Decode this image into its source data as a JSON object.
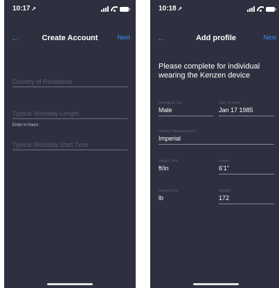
{
  "left": {
    "status_time": "10:17",
    "status_arrow": "➚",
    "title": "Create Account",
    "back": "←",
    "next": "Next",
    "fields": {
      "country_placeholder": "Country of Residence",
      "workday_length_placeholder": "Typical Workday Length",
      "workday_length_hint": "Enter in hours",
      "workday_start_placeholder": "Typical Workday Start Time"
    }
  },
  "right": {
    "status_time": "10:18",
    "status_arrow": "➚",
    "title": "Add profile",
    "back": "←",
    "next": "Next",
    "intro": "Please complete for individual wearing the Kenzen device",
    "biological_sex": {
      "label": "Biological Sex",
      "value": "Male"
    },
    "date_of_birth": {
      "label": "Date of Birth",
      "value": "Jan 17 1985"
    },
    "display_measurement": {
      "label": "Display Measurement",
      "value": "Imperial"
    },
    "height_unit": {
      "label": "Height Unit",
      "value": "ft/in"
    },
    "height": {
      "label": "Height",
      "value": "6'1\""
    },
    "weight_unit": {
      "label": "Weight Unit",
      "value": "lb"
    },
    "weight": {
      "label": "Weight",
      "value": "172"
    }
  },
  "icons": {
    "signal": "signal-icon",
    "wifi": "wifi-icon",
    "battery": "battery-icon",
    "back": "back-arrow-icon"
  },
  "colors": {
    "background": "#2e2f3f",
    "accent": "#3d8ff5",
    "placeholder": "#5d5f72",
    "divider": "#6e7082"
  }
}
